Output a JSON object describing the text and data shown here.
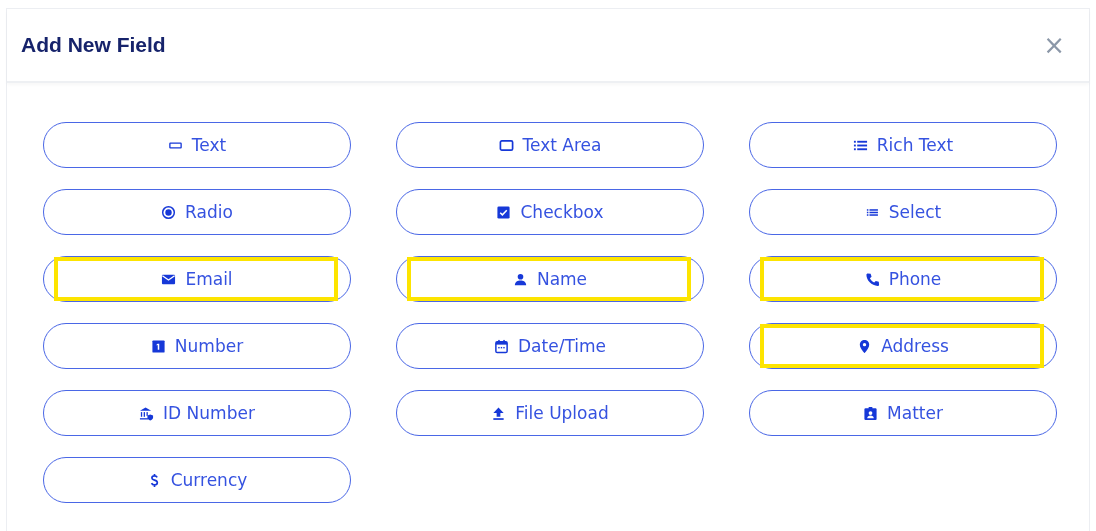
{
  "dialog": {
    "title": "Add New Field",
    "close": "×"
  },
  "fields": [
    {
      "label": "Text",
      "kind": "text",
      "highlighted": false
    },
    {
      "label": "Text Area",
      "kind": "textarea",
      "highlighted": false
    },
    {
      "label": "Rich Text",
      "kind": "richtext",
      "highlighted": false
    },
    {
      "label": "Radio",
      "kind": "radio",
      "highlighted": false
    },
    {
      "label": "Checkbox",
      "kind": "checkbox",
      "highlighted": false
    },
    {
      "label": "Select",
      "kind": "select",
      "highlighted": false
    },
    {
      "label": "Email",
      "kind": "email",
      "highlighted": true
    },
    {
      "label": "Name",
      "kind": "name",
      "highlighted": true
    },
    {
      "label": "Phone",
      "kind": "phone",
      "highlighted": true
    },
    {
      "label": "Number",
      "kind": "number",
      "highlighted": false
    },
    {
      "label": "Date/Time",
      "kind": "datetime",
      "highlighted": false
    },
    {
      "label": "Address",
      "kind": "address",
      "highlighted": true
    },
    {
      "label": "ID Number",
      "kind": "idnumber",
      "highlighted": false
    },
    {
      "label": "File Upload",
      "kind": "upload",
      "highlighted": false
    },
    {
      "label": "Matter",
      "kind": "matter",
      "highlighted": false
    },
    {
      "label": "Currency",
      "kind": "currency",
      "highlighted": false
    }
  ]
}
